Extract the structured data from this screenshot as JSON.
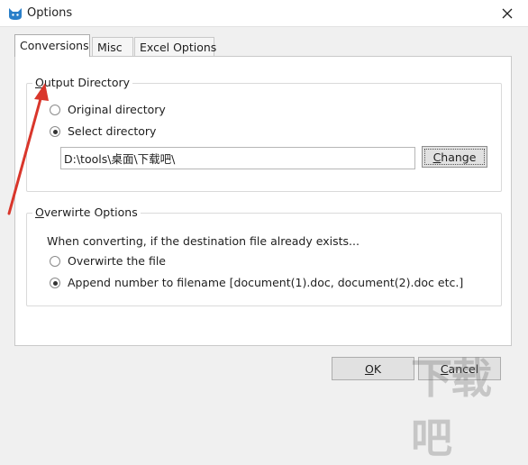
{
  "window": {
    "title": "Options",
    "close_icon": "close-icon",
    "app_icon": "cat-logo-icon"
  },
  "tabs": [
    {
      "label": "Conversions",
      "active": true
    },
    {
      "label": "Misc",
      "active": false
    },
    {
      "label": "Excel Options",
      "active": false
    }
  ],
  "output_directory": {
    "title_first": "O",
    "title_rest": "utput Directory",
    "options": [
      {
        "label": "Original directory",
        "selected": false
      },
      {
        "label": "Select directory",
        "selected": true
      }
    ],
    "path_value": "D:\\tools\\桌面\\下载吧\\",
    "change_first": "C",
    "change_rest": "hange"
  },
  "overwrite_options": {
    "title_first": "O",
    "title_rest": "verwirte Options",
    "description": "When converting, if the destination file already exists...",
    "options": [
      {
        "label": "Overwirte the file",
        "selected": false
      },
      {
        "label": "Append number to filename  [document(1).doc, document(2).doc etc.]",
        "selected": true
      }
    ]
  },
  "footer": {
    "ok_first": "O",
    "ok_rest": "K",
    "cancel_first": "C",
    "cancel_rest": "ancel"
  },
  "colors": {
    "annotation_arrow": "#d9362b",
    "watermark": "#8c8c8c"
  },
  "watermark_text": "下载吧"
}
